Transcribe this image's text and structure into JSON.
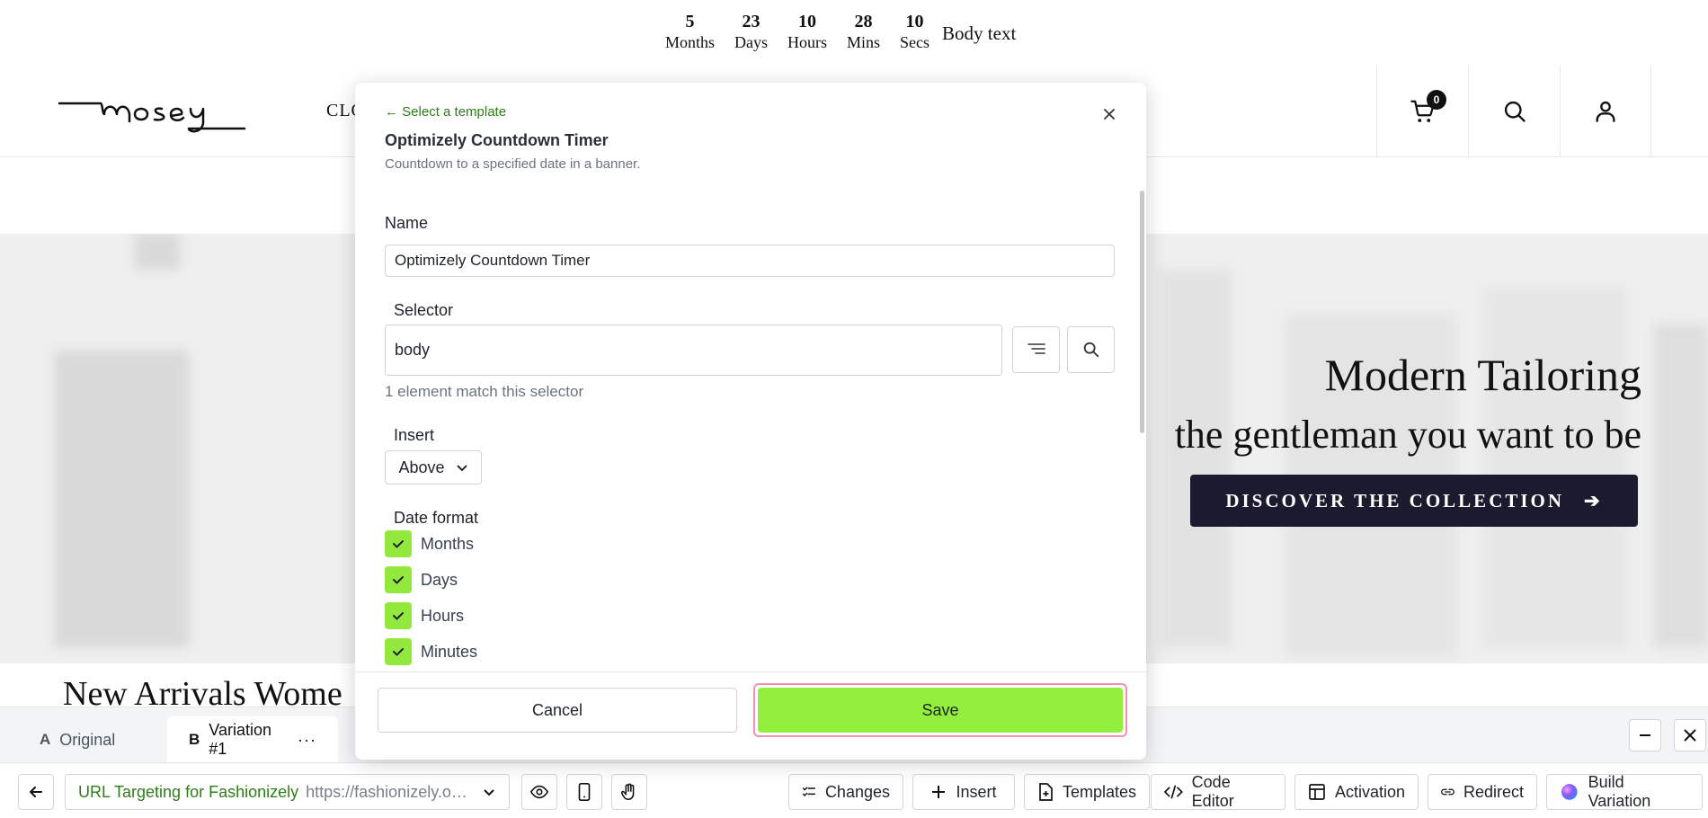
{
  "countdown": {
    "units": [
      {
        "value": "5",
        "label": "Months"
      },
      {
        "value": "23",
        "label": "Days"
      },
      {
        "value": "10",
        "label": "Hours"
      },
      {
        "value": "28",
        "label": "Mins"
      },
      {
        "value": "10",
        "label": "Secs"
      }
    ],
    "body_text": "Body text"
  },
  "site": {
    "logo_text": "mosey",
    "nav_partial": "CLO",
    "cart_count": "0",
    "hero_title": "Modern Tailoring",
    "hero_subtitle": "the gentleman you want to be",
    "hero_cta": "DISCOVER THE COLLECTION",
    "hero_cta_arrow": "➔",
    "section_title": "New Arrivals Wome"
  },
  "modal": {
    "back_link": "← Select a template",
    "title": "Optimizely Countdown Timer",
    "description": "Countdown to a specified date in a banner.",
    "name_label": "Name",
    "name_value": "Optimizely Countdown Timer",
    "selector_label": "Selector",
    "selector_value": "body",
    "match_text": "1 element match this selector",
    "insert_label": "Insert",
    "insert_value": "Above",
    "date_format_label": "Date format",
    "date_format_options": [
      {
        "label": "Months",
        "checked": true
      },
      {
        "label": "Days",
        "checked": true
      },
      {
        "label": "Hours",
        "checked": true
      },
      {
        "label": "Minutes",
        "checked": true
      }
    ],
    "cancel_label": "Cancel",
    "save_label": "Save"
  },
  "variation_bar": {
    "tabs": [
      {
        "letter": "A",
        "label": "Original"
      },
      {
        "letter": "B",
        "label": "Variation #1",
        "more": "···"
      }
    ]
  },
  "toolbar": {
    "url_targeting_name": "URL Targeting for Fashionizely",
    "url_targeting_value": "https://fashionizely.optimizely.com",
    "buttons": {
      "changes": "Changes",
      "insert": "Insert",
      "templates": "Templates",
      "code_editor": "Code Editor",
      "activation": "Activation",
      "redirect": "Redirect",
      "build_variation": "Build Variation"
    }
  },
  "colors": {
    "accent_green": "#93ef3d",
    "link_green": "#2e7d1a",
    "save_focus_ring": "#f48fb1",
    "cta_navy": "#1c1a2e"
  }
}
